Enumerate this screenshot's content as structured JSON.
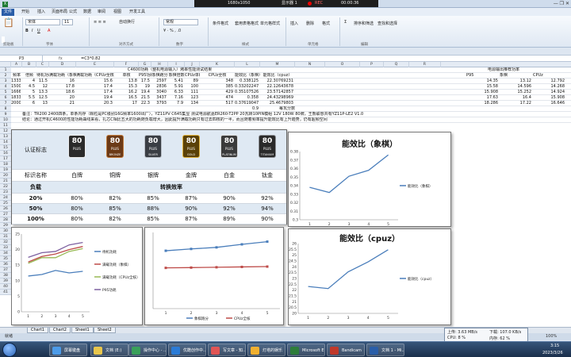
{
  "window": {
    "resolution": "1680x1050",
    "display": "显示器 1",
    "rec": "REC",
    "rec_time": "00:00:36"
  },
  "menu": [
    "文件",
    "开始",
    "插入",
    "页面布局",
    "公式",
    "数据",
    "审阅",
    "视图",
    "开发工具"
  ],
  "ribbon": {
    "font": "宋体",
    "size": "11",
    "wrap": "自动换行",
    "format": "常规",
    "groups": [
      "剪贴板",
      "字体",
      "对齐方式",
      "数字",
      "样式",
      "单元格",
      "编辑"
    ],
    "buttons": [
      "条件格式",
      "套用表格格式",
      "单元格样式",
      "插入",
      "删除",
      "格式",
      "排序和筛选",
      "查找和选择"
    ]
  },
  "formula": {
    "cell": "P3",
    "fx": "fx",
    "text": "=C3*0.82"
  },
  "columns": [
    "A",
    "B",
    "C",
    "D",
    "E",
    "F",
    "G",
    "H",
    "I",
    "J",
    "K",
    "L",
    "M",
    "N",
    "O",
    "P",
    "Q",
    "R"
  ],
  "table": {
    "title": "C4600功耗（整机电源输入）烤串性能测试结果",
    "headers": [
      "频率",
      "倍频",
      "待机功耗",
      "满载功耗（象棋）",
      "满载功耗（CPUz全核）",
      "单核",
      "P95功耗",
      "象棋跑分",
      "象棋倍数",
      "CPUz单核",
      "CPUz全核",
      "能效比（象棋）",
      "能效比（cpuz）"
    ],
    "rows": [
      [
        "1333",
        "4",
        "11.5",
        "16",
        "15.6",
        "13.8",
        "17.5",
        "2597",
        "5.41",
        "89",
        "348",
        "0.338125",
        "22.30769231"
      ],
      [
        "1500",
        "4.5",
        "12",
        "17.8",
        "17.4",
        "15.3",
        "19",
        "2836",
        "5.91",
        "100",
        "385",
        "0.332022472",
        "22.12643678"
      ],
      [
        "1666",
        "5",
        "13.3",
        "18.6",
        "17.4",
        "16.2",
        "19.4",
        "3040",
        "6.33",
        "111",
        "429",
        "0.351075269",
        "23.57142857"
      ],
      [
        "1833",
        "5.5",
        "12.5",
        "20",
        "19.4",
        "16.5",
        "21.5",
        "3437",
        "7.16",
        "123",
        "474",
        "0.358",
        "24.43298969"
      ],
      [
        "2000",
        "6",
        "13",
        "21",
        "20.3",
        "17",
        "22.3",
        "3793",
        "7.9",
        "134",
        "517",
        "0.376190476",
        "25.4679803"
      ]
    ],
    "row_labels": [
      "1",
      "2",
      "3",
      "4",
      "5",
      "6",
      "7",
      "8",
      "9",
      "10",
      "11",
      "12",
      "13",
      "14",
      "15",
      "16",
      "17",
      "18",
      "19",
      "20",
      "21",
      "22",
      "23",
      "24",
      "25",
      "26",
      "27",
      "28",
      "29",
      "30",
      "31",
      "32",
      "33",
      "34",
      "35",
      "36",
      "37",
      "38",
      "39",
      "40",
      "41"
    ],
    "row8_cell": "0.9",
    "row8_note": "每瓦分数",
    "note1": "备注：TR200 2400四条，单条内存（颗粒是PC级别16G频率1600出厂），YZ11PV C645集显 测试电源航嘉ER260-T2PP 20瓦转10PIN模组 12V 180W 80牌，王熊联想共有YZ11P-LE2 V1.0",
    "note1_red": "80牌",
    "note2": "结论：通过开机C4600的性能功耗曲线来看，扎芯C相比五大的功耗随负载增大，因此提升满载功耗只有过去四核的一半，而且随着频率提升能效比有上升趋势，仍有超频空间",
    "side": {
      "title": "电源输出推荐功率",
      "headers": [
        "P95",
        "象棋",
        "CPUz"
      ],
      "rows": [
        [
          "14.35",
          "13.12",
          "12.792"
        ],
        [
          "15.58",
          "14.596",
          "14.268"
        ],
        [
          "15.908",
          "15.252",
          "14.924"
        ],
        [
          "17.63",
          "16.4",
          "15.908"
        ],
        [
          "18.286",
          "17.22",
          "16.646"
        ]
      ]
    }
  },
  "badges": {
    "title": "认证标志",
    "name_label": "标识名称",
    "load_label": "负载",
    "eff_label": "转换效率",
    "items": [
      {
        "name": "白牌",
        "tag": "PLUS",
        "sub": "",
        "color": "#2b2b2b",
        "rim": "#eeeeee"
      },
      {
        "name": "铜牌",
        "tag": "PLUS",
        "sub": "BRONZE",
        "color": "#6b3a17",
        "rim": "#c27a3a"
      },
      {
        "name": "银牌",
        "tag": "PLUS",
        "sub": "SILVER",
        "color": "#3a3e44",
        "rim": "#b8bec6"
      },
      {
        "name": "金牌",
        "tag": "PLUS",
        "sub": "GOLD",
        "color": "#5a4108",
        "rim": "#e0b23a"
      },
      {
        "name": "白金",
        "tag": "PLUS",
        "sub": "PLATINUM",
        "color": "#3a3a3a",
        "rim": "#d9d9d9"
      },
      {
        "name": "钛金",
        "tag": "PLUS",
        "sub": "TITANIUM",
        "color": "#2a2a2a",
        "rim": "#8c8f93"
      }
    ],
    "logo_text": "80",
    "loads": [
      {
        "load": "20%",
        "vals": [
          "80%",
          "82%",
          "85%",
          "87%",
          "90%",
          "92%"
        ]
      },
      {
        "load": "50%",
        "vals": [
          "80%",
          "85%",
          "88%",
          "90%",
          "92%",
          "94%"
        ]
      },
      {
        "load": "100%",
        "vals": [
          "80%",
          "82%",
          "85%",
          "87%",
          "89%",
          "90%"
        ]
      }
    ]
  },
  "chart_data": [
    {
      "type": "line",
      "title": "能效比（象棋）",
      "categories": [
        "1",
        "2",
        "3",
        "4",
        "5"
      ],
      "series": [
        {
          "name": "能效比（象棋）",
          "values": [
            0.338,
            0.332,
            0.351,
            0.358,
            0.376
          ],
          "color": "#4a7ebb"
        }
      ],
      "ylim": [
        0.3,
        0.38
      ],
      "yticks": [
        "0.3",
        "0.31",
        "0.32",
        "0.33",
        "0.34",
        "0.35",
        "0.36",
        "0.37",
        "0.38"
      ]
    },
    {
      "type": "line",
      "title": "能效比（cpuz）",
      "categories": [
        "1",
        "2",
        "3",
        "4",
        "5"
      ],
      "series": [
        {
          "name": "能效比（cpuz）",
          "values": [
            22.31,
            22.13,
            23.57,
            24.43,
            25.47
          ],
          "color": "#4a7ebb"
        }
      ],
      "ylim": [
        20,
        26
      ],
      "yticks": [
        "20",
        "20.5",
        "21",
        "21.5",
        "22",
        "22.5",
        "23",
        "23.5",
        "24",
        "24.5",
        "25",
        "25.5",
        "26"
      ]
    },
    {
      "type": "line",
      "title": "",
      "categories": [
        "1",
        "2",
        "3",
        "4",
        "5"
      ],
      "series": [
        {
          "name": "待机功耗",
          "values": [
            11.5,
            12,
            13.3,
            12.5,
            13
          ],
          "color": "#4a7ebb"
        },
        {
          "name": "满载功耗（象棋）",
          "values": [
            16,
            17.8,
            18.6,
            20,
            21
          ],
          "color": "#be4b48"
        },
        {
          "name": "满载功耗（CPUz全核）",
          "values": [
            15.6,
            17.4,
            17.4,
            19.4,
            20.3
          ],
          "color": "#98b954"
        },
        {
          "name": "P95功耗",
          "values": [
            17.5,
            19,
            19.4,
            21.5,
            22.3
          ],
          "color": "#7d60a0"
        }
      ],
      "ylim": [
        0,
        25
      ],
      "yticks": [
        "0",
        "5",
        "10",
        "15",
        "20",
        "25"
      ]
    },
    {
      "type": "line",
      "title": "",
      "categories": [
        "1",
        "2",
        "3",
        "4",
        "5"
      ],
      "series": [
        {
          "name": "象棋跑分",
          "values": [
            2597,
            2836,
            3040,
            3437,
            3793
          ],
          "color": "#4a7ebb"
        },
        {
          "name": "CPUz全核",
          "values": [
            348,
            385,
            429,
            474,
            517
          ],
          "color": "#be4b48"
        }
      ],
      "ylim": [
        -5000,
        5000
      ]
    }
  ],
  "sheets": [
    "Chart1",
    "Chart2",
    "Sheet1",
    "Sheet2"
  ],
  "status": {
    "ready": "就绪",
    "zoom": "100%"
  },
  "netmon": {
    "up": "上传: 3.63 MB/s",
    "down": "下载: 107.0 KB/s",
    "cpu": "CPU: 8 %",
    "mem": "内存: 62 %"
  },
  "taskbar": {
    "items": [
      "屏幕键盘",
      "文档 (E:)",
      "操作中心 - ...",
      "优酷创作中...",
      "写文章 - 知...",
      "灯塔的娱乐",
      "Microsoft E...",
      "Bandicam",
      "文档 1 - Mi..."
    ],
    "time": "3:15",
    "date": "2023/3/26"
  }
}
